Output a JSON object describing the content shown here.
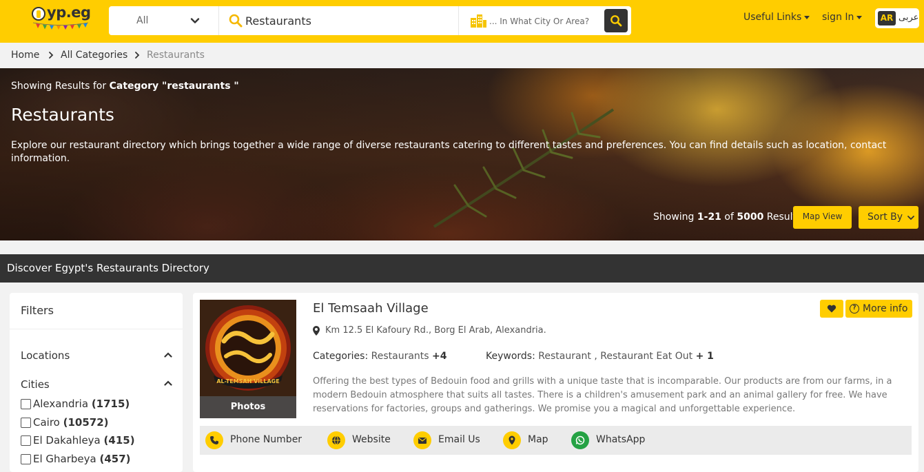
{
  "header": {
    "logo_text": "yp.eg",
    "category_select": "All",
    "search_value": "Restaurants",
    "city_placeholder": "... In What City Or Area?",
    "useful_links": "Useful Links",
    "sign_in": "sign In",
    "lang_code": "AR",
    "lang_label": "عربى",
    "brand_color": "#ffcd00"
  },
  "breadcrumb": {
    "items": [
      "Home",
      "All Categories",
      "Restaurants"
    ]
  },
  "hero": {
    "showing_prefix": "Showing Results for",
    "showing_category": "Category \"restaurants \"",
    "title": "Restaurants",
    "description": "Explore our restaurant directory which brings together a wide range of diverse restaurants catering to different tastes and preferences. You can find details such as location, contact information.",
    "result_prefix": "Showing",
    "result_range": "1-21",
    "result_of": "of",
    "result_total": "5000",
    "result_suffix": "Result",
    "map_view": "Map View",
    "sort_by": "Sort By"
  },
  "directory_bar": {
    "title": "Discover Egypt's Restaurants Directory"
  },
  "filters": {
    "title": "Filters",
    "locations_label": "Locations",
    "cities_label": "Cities",
    "cities": [
      {
        "name": "Alexandria",
        "count": "(1715)"
      },
      {
        "name": "Cairo",
        "count": "(10572)"
      },
      {
        "name": "El Dakahleya",
        "count": "(415)"
      },
      {
        "name": "El Gharbeya",
        "count": "(457)"
      }
    ]
  },
  "listing": {
    "name": "El Temsaah Village",
    "photos_label": "Photos",
    "logo_text_latin": "AL-TEMSAH VILLAGE",
    "more_info": "More info",
    "address": "Km 12.5 El Kafoury Rd., Borg El Arab, Alexandria.",
    "categories_label": "Categories:",
    "categories_value": "Restaurants",
    "categories_more": "+4",
    "keywords_label": "Keywords:",
    "keywords_value": "Restaurant , Restaurant Eat Out",
    "keywords_more": "+ 1",
    "description": "Offering the best types of Bedouin food and grills with a unique taste that is incomparable. Our products are from our farms, in a modern Bedouin atmosphere that suits all tastes. There is a children's amusement park and an animal gallery for free. We have reservations for factories, groups and gatherings. We promise you a magical and unforgettable experience.",
    "actions": {
      "phone": "Phone Number",
      "website": "Website",
      "email": "Email Us",
      "map": "Map",
      "whatsapp": "WhatsApp"
    }
  }
}
